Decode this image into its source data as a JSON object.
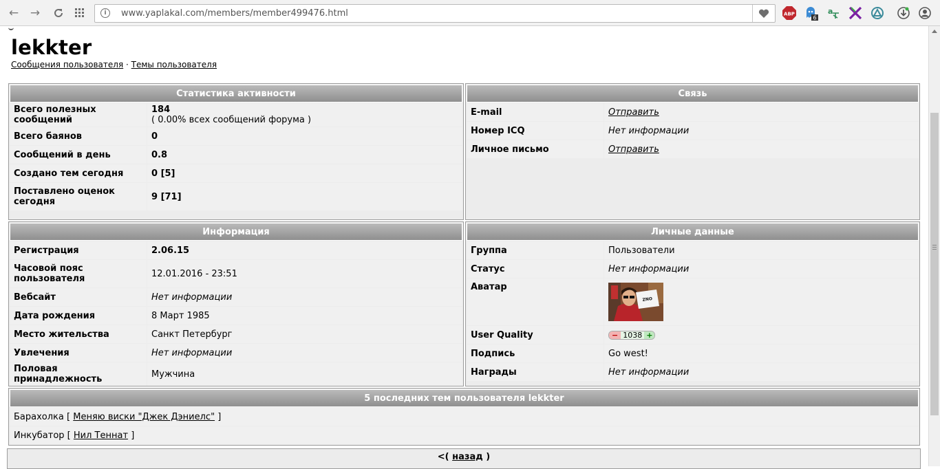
{
  "browser": {
    "url": "www.yaplakal.com/members/member499476.html",
    "extensions": [
      {
        "name": "adblock-icon",
        "label": "ABP",
        "color": "#c0272d"
      },
      {
        "name": "ghostery-icon",
        "badge": "6",
        "color": "#3c8bd4"
      },
      {
        "name": "translate-icon",
        "label": "a",
        "color": "#2e8b57"
      },
      {
        "name": "x-extension-icon",
        "color": "#7a1fa2"
      },
      {
        "name": "shield-extension-icon",
        "color": "#3a8a9a"
      },
      {
        "name": "download-extension-icon",
        "color": "#555555"
      },
      {
        "name": "profile-icon",
        "color": "#555555"
      }
    ]
  },
  "page": {
    "username": "lekkter",
    "links": {
      "posts": "Сообщения пользователя",
      "separator": "·",
      "topics": "Темы пользователя"
    }
  },
  "stats": {
    "title": "Статистика активности",
    "rows": [
      {
        "label": "Всего полезных сообщений",
        "value": "184",
        "sub": "( 0.00% всех сообщений форума )"
      },
      {
        "label": "Всего баянов",
        "value": "0"
      },
      {
        "label": "Сообщений в день",
        "value": "0.8"
      },
      {
        "label": "Создано тем сегодня",
        "value": "0 [5]"
      },
      {
        "label": "Поставлено оценок сегодня",
        "value": "9 [71]"
      }
    ]
  },
  "contact": {
    "title": "Связь",
    "rows": [
      {
        "label": "E-mail",
        "value": "Отправить"
      },
      {
        "label": "Номер ICQ",
        "value": "Нет информации"
      },
      {
        "label": "Личное письмо",
        "value": "Отправить"
      }
    ]
  },
  "info": {
    "title": "Информация",
    "rows": [
      {
        "label": "Регистрация",
        "value": "2.06.15"
      },
      {
        "label": "Часовой пояс пользователя",
        "value": "12.01.2016 - 23:51"
      },
      {
        "label": "Вебсайт",
        "value": "Нет информации"
      },
      {
        "label": "Дата рождения",
        "value": "8 Март 1985"
      },
      {
        "label": "Место жительства",
        "value": "Санкт Петербург"
      },
      {
        "label": "Увлечения",
        "value": "Нет информации"
      },
      {
        "label": "Половая принадлежность",
        "value": "Мужчина"
      }
    ]
  },
  "personal": {
    "title": "Личные данные",
    "rows": [
      {
        "label": "Группа",
        "value": "Пользователи"
      },
      {
        "label": "Статус",
        "value": "Нет информации"
      },
      {
        "label": "Аватар"
      },
      {
        "label": "User Quality",
        "minus": "−",
        "value": "1038",
        "plus": "+"
      },
      {
        "label": "Подпись",
        "value": "Go west!"
      },
      {
        "label": "Награды",
        "value": "Нет информации"
      }
    ]
  },
  "recent": {
    "title": "5 последних тем пользователя lekkter",
    "items": [
      {
        "section": "Барахолка",
        "topic": "Меняю виски \"Джек Дэниелс\""
      },
      {
        "section": "Инкубатор",
        "topic": "Нил Теннат"
      }
    ],
    "open": "[",
    "close": "]"
  },
  "footer": {
    "prefix": "<(",
    "back": "назад",
    "suffix": ")"
  }
}
